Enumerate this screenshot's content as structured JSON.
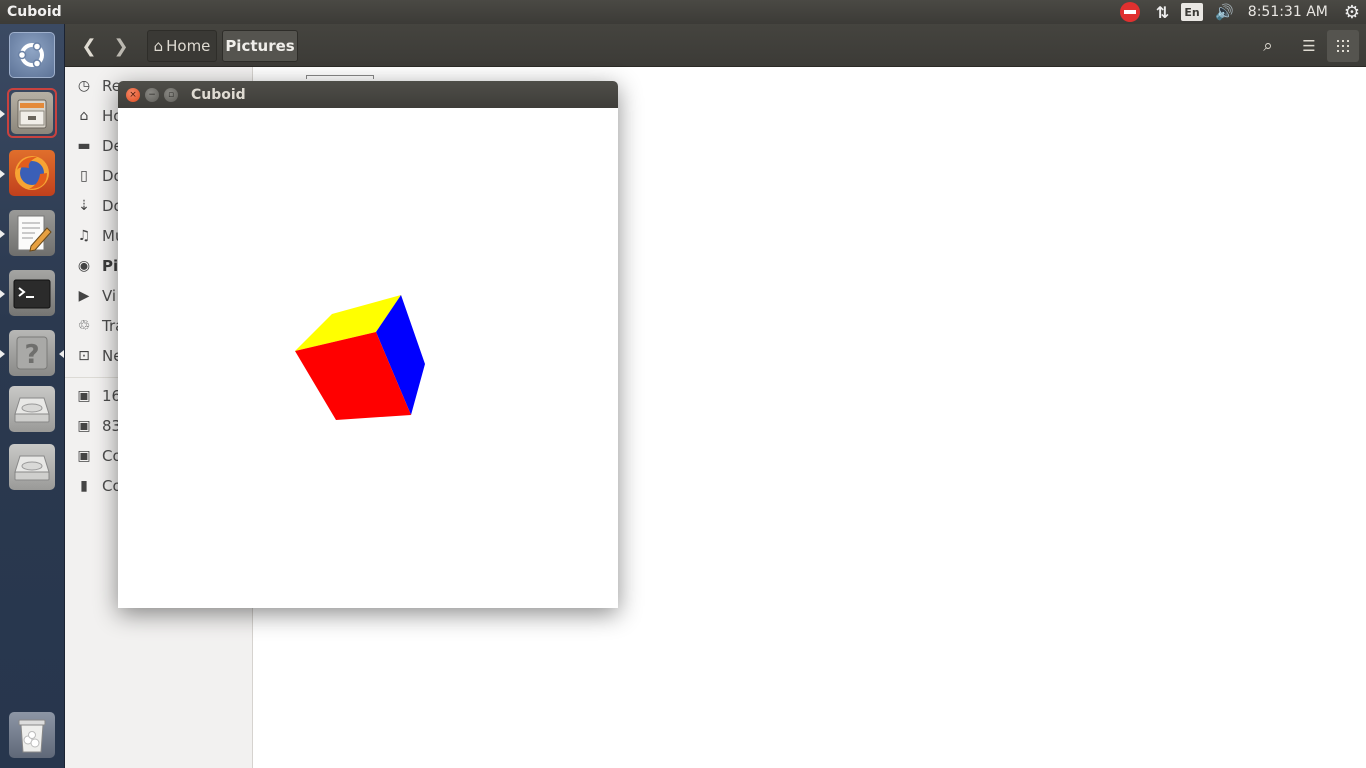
{
  "top_panel": {
    "app_title": "Cuboid",
    "clock": "8:51:31 AM",
    "language": "En",
    "network_icon": "⇅",
    "sound_icon": "🔊",
    "gear_icon": "⚙"
  },
  "launcher": {
    "items": [
      "dash-home",
      "files",
      "firefox",
      "text-editor",
      "terminal",
      "help",
      "drive",
      "drive",
      "trash"
    ]
  },
  "nautilus": {
    "back_icon": "❮",
    "forward_icon": "❯",
    "path": {
      "home": "Home",
      "current": "Pictures"
    },
    "search_icon": "⌕",
    "list_icon": "☰",
    "grid_icon": "⋮⋮",
    "sidebar": [
      {
        "icon": "◷",
        "label": "Re"
      },
      {
        "icon": "⌂",
        "label": "Ho"
      },
      {
        "icon": "▬",
        "label": "De"
      },
      {
        "icon": "▯",
        "label": "Do"
      },
      {
        "icon": "⇣",
        "label": "Do"
      },
      {
        "icon": "♫",
        "label": "Mu"
      },
      {
        "icon": "◉",
        "label": "Pic"
      },
      {
        "icon": "▶",
        "label": "Vi"
      },
      {
        "icon": "♲",
        "label": "Tra"
      },
      {
        "icon": "⊡",
        "label": "Ne"
      },
      {
        "icon": "▣",
        "label": "16"
      },
      {
        "icon": "▣",
        "label": "83"
      },
      {
        "icon": "▣",
        "label": "Co"
      },
      {
        "icon": "▮",
        "label": "Co"
      }
    ]
  },
  "cuboid_window": {
    "title": "Cuboid",
    "close_icon": "×",
    "minimize_icon": "−",
    "maximize_icon": "▫",
    "face_colors": {
      "top": "#ffff00",
      "front": "#ff0000",
      "side": "#0000ff"
    }
  }
}
